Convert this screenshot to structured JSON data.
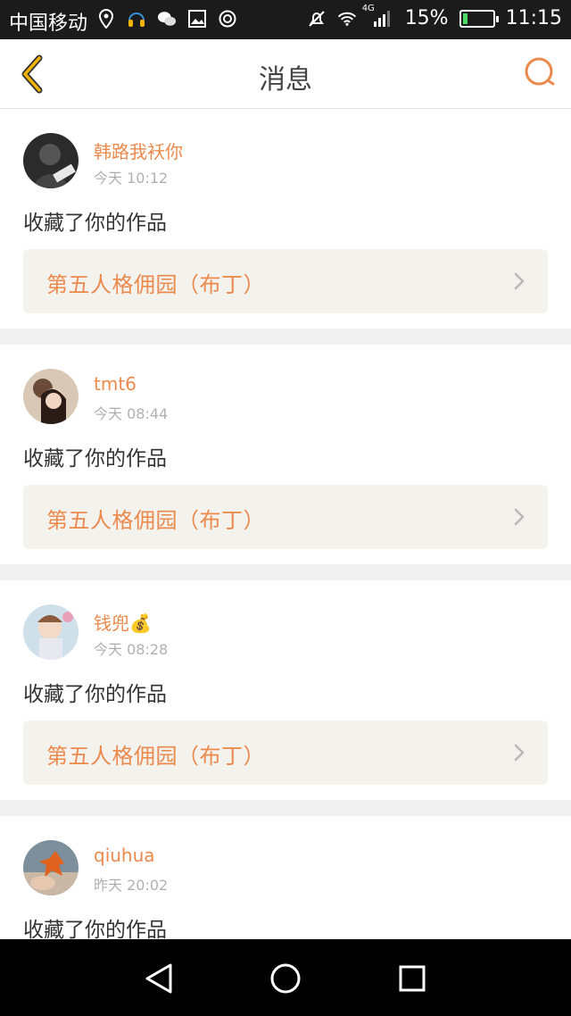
{
  "status_bar": {
    "carrier": "中国移动",
    "left_icons": [
      "location-icon",
      "headset-icon",
      "wechat-icon",
      "image-icon",
      "sync-icon"
    ],
    "network": "4G",
    "battery": "15%",
    "battery_level": 0.15,
    "time": "11:15"
  },
  "header": {
    "title": "消息"
  },
  "colors": {
    "accent": "#ec8a4e",
    "back_arrow": "#f2b400",
    "card_bg": "#f4f2ec"
  },
  "messages": [
    {
      "username": "韩路我袄你",
      "time": "今天 10:12",
      "action": "收藏了你的作品",
      "work": "第五人格佣园（布丁）"
    },
    {
      "username": "tmt6",
      "time": "今天 08:44",
      "action": "收藏了你的作品",
      "work": "第五人格佣园（布丁）"
    },
    {
      "username": "钱兜💰",
      "time": "今天 08:28",
      "action": "收藏了你的作品",
      "work": "第五人格佣园（布丁）"
    },
    {
      "username": "qiuhua",
      "time": "昨天 20:02",
      "action": "收藏了你的作品",
      "work": ""
    }
  ]
}
